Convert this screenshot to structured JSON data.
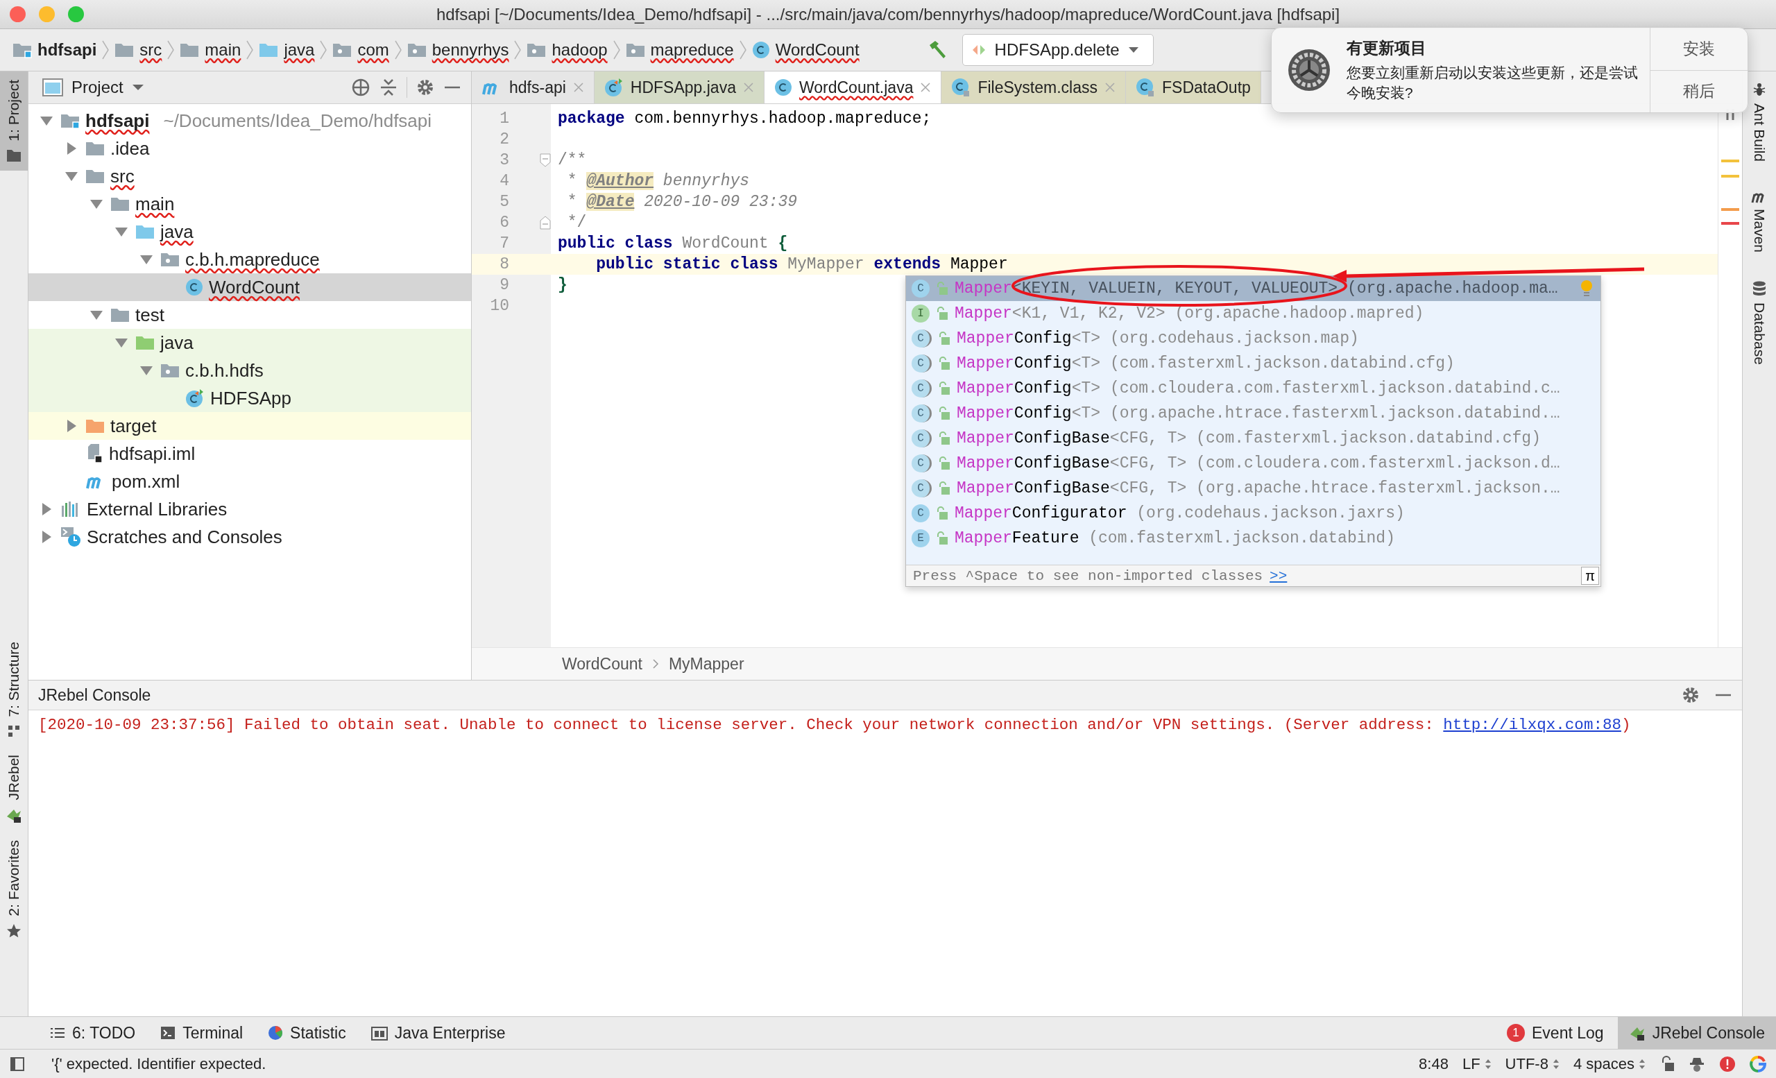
{
  "window": {
    "title": "hdfsapi [~/Documents/Idea_Demo/hdfsapi] - .../src/main/java/com/bennyrhys/hadoop/mapreduce/WordCount.java [hdfsapi]"
  },
  "nav_bar": {
    "crumbs": [
      {
        "label": "hdfsapi",
        "kind": "module",
        "error": false
      },
      {
        "label": "src",
        "kind": "folder",
        "error": true
      },
      {
        "label": "main",
        "kind": "folder",
        "error": true
      },
      {
        "label": "java",
        "kind": "source-root",
        "error": true
      },
      {
        "label": "com",
        "kind": "package",
        "error": true
      },
      {
        "label": "bennyrhys",
        "kind": "package",
        "error": true
      },
      {
        "label": "hadoop",
        "kind": "package",
        "error": true
      },
      {
        "label": "mapreduce",
        "kind": "package",
        "error": true
      },
      {
        "label": "WordCount",
        "kind": "class",
        "error": true
      }
    ],
    "run_config": "HDFSApp.delete"
  },
  "notification": {
    "title": "有更新项目",
    "message": "您要立刻重新启动以安装这些更新，还是尝试今晚安装?",
    "buttons": [
      "安装",
      "稍后"
    ]
  },
  "left_strip": {
    "top": [
      {
        "label": "1: Project",
        "kind": "project",
        "selected": true
      }
    ],
    "bottom": [
      {
        "label": "7: Structure",
        "kind": "structure",
        "selected": false
      },
      {
        "label": "JRebel",
        "kind": "jrebel",
        "selected": false
      },
      {
        "label": "2: Favorites",
        "kind": "star",
        "selected": false
      }
    ]
  },
  "right_strip": [
    {
      "label": "Ant Build",
      "kind": "ant"
    },
    {
      "label": "Maven",
      "kind": "maven"
    },
    {
      "label": "Database",
      "kind": "database"
    }
  ],
  "project_panel": {
    "title": "Project",
    "tree": [
      {
        "label": "hdfsapi",
        "hint": "~/Documents/Idea_Demo/hdfsapi",
        "kind": "module",
        "expanded": true,
        "error": true,
        "selected": false,
        "children": [
          {
            "label": ".idea",
            "kind": "folder",
            "expanded": false,
            "error": false,
            "selected": false
          },
          {
            "label": "src",
            "kind": "folder",
            "expanded": true,
            "error": true,
            "selected": false,
            "children": [
              {
                "label": "main",
                "kind": "folder",
                "expanded": true,
                "error": true,
                "selected": false,
                "children": [
                  {
                    "label": "java",
                    "kind": "source-root",
                    "expanded": true,
                    "error": true,
                    "selected": false,
                    "children": [
                      {
                        "label": "c.b.h.mapreduce",
                        "kind": "package",
                        "expanded": true,
                        "error": true,
                        "selected": false,
                        "children": [
                          {
                            "label": "WordCount",
                            "kind": "class",
                            "error": true,
                            "selected": true
                          }
                        ]
                      }
                    ]
                  }
                ]
              },
              {
                "label": "test",
                "kind": "folder",
                "expanded": true,
                "error": false,
                "selected": false,
                "children": [
                  {
                    "label": "java",
                    "kind": "test-root",
                    "expanded": true,
                    "error": false,
                    "selected": false,
                    "children": [
                      {
                        "label": "c.b.h.hdfs",
                        "kind": "package",
                        "expanded": true,
                        "error": false,
                        "selected": false,
                        "children": [
                          {
                            "label": "HDFSApp",
                            "kind": "runnable-class",
                            "error": false,
                            "selected": false
                          }
                        ]
                      }
                    ]
                  }
                ]
              }
            ]
          },
          {
            "label": "target",
            "kind": "excluded-folder",
            "expanded": false,
            "error": false,
            "selected": false
          },
          {
            "label": "hdfsapi.iml",
            "kind": "iml",
            "error": false,
            "selected": false
          },
          {
            "label": "pom.xml",
            "kind": "maven",
            "error": false,
            "selected": false
          }
        ]
      },
      {
        "label": "External Libraries",
        "kind": "libraries",
        "expanded": false,
        "error": false,
        "selected": false
      },
      {
        "label": "Scratches and Consoles",
        "kind": "scratches",
        "expanded": false,
        "error": false,
        "selected": false
      }
    ]
  },
  "editor": {
    "tabs": [
      {
        "label": "hdfs-api",
        "kind": "maven",
        "selected": false,
        "error": false,
        "close_button": true
      },
      {
        "label": "HDFSApp.java",
        "kind": "runnable-class",
        "selected": false,
        "error": false,
        "close_button": true
      },
      {
        "label": "WordCount.java",
        "kind": "class",
        "selected": true,
        "error": true,
        "close_button": true
      },
      {
        "label": "FileSystem.class",
        "kind": "library-class",
        "selected": false,
        "error": false,
        "close_button": true
      },
      {
        "label": "FSDataOutp",
        "kind": "library-class",
        "selected": false,
        "error": false,
        "close_button": false
      }
    ],
    "lines": [
      {
        "number": "1",
        "current": false,
        "fold_start": false,
        "fold_end": false,
        "tokens": [
          {
            "t": "package",
            "kind": "keyword"
          },
          {
            "t": " com.bennyrhys.hadoop.mapreduce;",
            "kind": "plain"
          }
        ]
      },
      {
        "number": "2",
        "current": false,
        "fold_start": false,
        "fold_end": false
      },
      {
        "number": "3",
        "current": false,
        "fold_start": true,
        "fold_end": false,
        "tokens": [
          {
            "t": "/**",
            "kind": "comment"
          }
        ]
      },
      {
        "number": "4",
        "current": false,
        "fold_start": false,
        "fold_end": false,
        "tokens": [
          {
            "t": " * ",
            "kind": "comment"
          },
          {
            "t": "@Author",
            "kind": "doc-tag"
          },
          {
            "t": " bennyrhys",
            "kind": "doc-value"
          }
        ]
      },
      {
        "number": "5",
        "current": false,
        "fold_start": false,
        "fold_end": false,
        "tokens": [
          {
            "t": " * ",
            "kind": "comment"
          },
          {
            "t": "@Date",
            "kind": "doc-tag"
          },
          {
            "t": " 2020-10-09 23:39",
            "kind": "doc-value"
          }
        ]
      },
      {
        "number": "6",
        "current": false,
        "fold_start": false,
        "fold_end": true,
        "tokens": [
          {
            "t": " */",
            "kind": "comment"
          }
        ]
      },
      {
        "number": "7",
        "current": false,
        "fold_start": false,
        "fold_end": false,
        "tokens": [
          {
            "t": "public class",
            "kind": "keyword"
          },
          {
            "t": " WordCount ",
            "kind": "unused"
          },
          {
            "t": "{",
            "kind": "brace"
          }
        ]
      },
      {
        "number": "8",
        "current": true,
        "fold_start": false,
        "fold_end": false,
        "tokens": [
          {
            "t": "    public static class",
            "kind": "keyword"
          },
          {
            "t": " MyMapper ",
            "kind": "unused"
          },
          {
            "t": "extends",
            "kind": "keyword"
          },
          {
            "t": " Mapper",
            "kind": "plain"
          }
        ]
      },
      {
        "number": "9",
        "current": false,
        "fold_start": false,
        "fold_end": false,
        "tokens": [
          {
            "t": "}",
            "kind": "brace"
          }
        ]
      },
      {
        "number": "10",
        "current": false,
        "fold_start": false,
        "fold_end": false
      }
    ],
    "breadcrumbs": [
      "WordCount",
      "MyMapper"
    ],
    "completion": {
      "items": [
        {
          "letter": "C",
          "kind": "class",
          "match": "Mapper",
          "signature": "<KEYIN, VALUEIN, KEYOUT, VALUEOUT>",
          "package": " (org.apache.hadoop.ma…",
          "selected": true
        },
        {
          "letter": "I",
          "kind": "interface",
          "match": "Mapper",
          "signature": "<K1, V1, K2, V2>",
          "package": " (org.apache.hadoop.mapred)",
          "selected": false
        },
        {
          "letter": "C",
          "kind": "lib-class",
          "match": "Mapper",
          "rest": "Config",
          "signature": "<T>",
          "package": " (org.codehaus.jackson.map)",
          "selected": false
        },
        {
          "letter": "C",
          "kind": "lib-class",
          "match": "Mapper",
          "rest": "Config",
          "signature": "<T>",
          "package": " (com.fasterxml.jackson.databind.cfg)",
          "selected": false
        },
        {
          "letter": "C",
          "kind": "lib-class",
          "match": "Mapper",
          "rest": "Config",
          "signature": "<T>",
          "package": " (com.cloudera.com.fasterxml.jackson.databind.c…",
          "selected": false
        },
        {
          "letter": "C",
          "kind": "lib-class",
          "match": "Mapper",
          "rest": "Config",
          "signature": "<T>",
          "package": " (org.apache.htrace.fasterxml.jackson.databind.…",
          "selected": false
        },
        {
          "letter": "C",
          "kind": "lib-class",
          "match": "Mapper",
          "rest": "ConfigBase",
          "signature": "<CFG, T>",
          "package": " (com.fasterxml.jackson.databind.cfg)",
          "selected": false
        },
        {
          "letter": "C",
          "kind": "lib-class",
          "match": "Mapper",
          "rest": "ConfigBase",
          "signature": "<CFG, T>",
          "package": " (com.cloudera.com.fasterxml.jackson.d…",
          "selected": false
        },
        {
          "letter": "C",
          "kind": "lib-class",
          "match": "Mapper",
          "rest": "ConfigBase",
          "signature": "<CFG, T>",
          "package": " (org.apache.htrace.fasterxml.jackson.…",
          "selected": false
        },
        {
          "letter": "C",
          "kind": "class",
          "match": "Mapper",
          "rest": "Configurator",
          "package": " (org.codehaus.jackson.jaxrs)",
          "selected": false
        },
        {
          "letter": "E",
          "kind": "enum",
          "match": "Mapper",
          "rest": "Feature",
          "package": " (com.fasterxml.jackson.databind)",
          "selected": false
        }
      ],
      "hint": "Press ^Space to see non-imported classes",
      "hint_link": ">>",
      "pi_button": "π"
    }
  },
  "console": {
    "title": "JRebel Console",
    "message": {
      "before": "[2020-10-09 23:37:56] Failed to obtain seat. Unable to connect to license server. Check your network connection and/or VPN settings. (Server address: ",
      "link": "http://ilxqx.com:88",
      "after": ")"
    }
  },
  "bottom_tabs": {
    "left": [
      {
        "label": "6: TODO",
        "kind": "todo",
        "selected": false
      },
      {
        "label": "Terminal",
        "kind": "terminal",
        "selected": false
      },
      {
        "label": "Statistic",
        "kind": "statistic",
        "selected": false
      },
      {
        "label": "Java Enterprise",
        "kind": "enterprise",
        "selected": false
      }
    ],
    "right": [
      {
        "label": "Event Log",
        "badge": "1",
        "selected": false
      },
      {
        "label": "JRebel Console",
        "kind": "jrebel",
        "selected": true
      }
    ]
  },
  "status_bar": {
    "message": "'{' expected. Identifier expected.",
    "items": [
      {
        "label": "8:48",
        "dropdown": false
      },
      {
        "label": "LF",
        "dropdown": true
      },
      {
        "label": "UTF-8",
        "dropdown": true
      },
      {
        "label": "4 spaces",
        "dropdown": true
      }
    ]
  }
}
